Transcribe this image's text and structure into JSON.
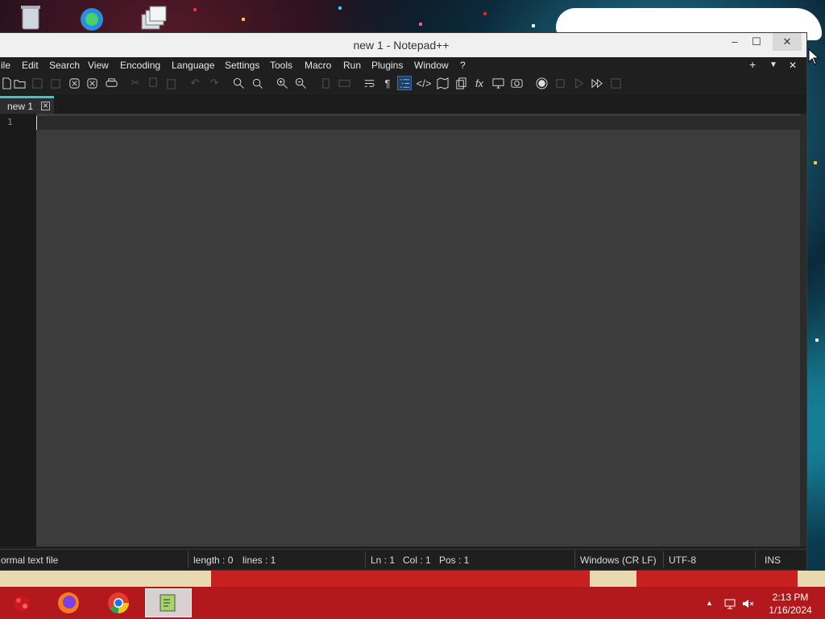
{
  "window": {
    "title": "new 1 - Notepad++",
    "controls": {
      "minimize": "–",
      "maximize": "☐",
      "close": "✕"
    }
  },
  "menubar": {
    "items": [
      "ile",
      "Edit",
      "Search",
      "View",
      "Encoding",
      "Language",
      "Settings",
      "Tools",
      "Macro",
      "Run",
      "Plugins",
      "Window",
      "?"
    ],
    "right": {
      "add": "+",
      "list": "▼",
      "close": "✕"
    }
  },
  "toolbar": {
    "buttons": [
      "new-file-icon",
      "open-file-icon",
      "save-icon",
      "save-all-icon",
      "close-icon",
      "close-all-icon",
      "print-icon",
      "cut-icon",
      "copy-icon",
      "paste-icon",
      "undo-icon",
      "redo-icon",
      "find-icon",
      "replace-icon",
      "zoom-in-icon",
      "zoom-out-icon",
      "sync-vertical-icon",
      "sync-horizontal-icon",
      "word-wrap-icon",
      "show-all-characters-icon",
      "indent-guide-icon",
      "udl-icon",
      "document-map-icon",
      "document-list-icon",
      "function-list-icon",
      "folder-as-workspace-icon",
      "monitoring-icon",
      "record-macro-icon",
      "stop-record-icon",
      "playback-macro-icon",
      "run-macro-multiple-icon",
      "save-macro-icon"
    ]
  },
  "tabs": [
    {
      "label": "new 1",
      "close": "✕"
    }
  ],
  "editor": {
    "line_numbers": [
      "1"
    ],
    "content": ""
  },
  "statusbar": {
    "file_type": "ormal text file",
    "length": "length : 0",
    "lines": "lines : 1",
    "ln": "Ln : 1",
    "col": "Col : 1",
    "pos": "Pos : 1",
    "eol": "Windows (CR LF)",
    "encoding": "UTF-8",
    "mode": "INS"
  },
  "taskbar": {
    "apps": [
      "start-icon",
      "firefox-icon",
      "chrome-icon",
      "notepadpp-icon"
    ],
    "clock_time": "2:13 PM",
    "clock_date": "1/16/2024"
  },
  "colors": {
    "accent_tab": "#3ec9b7",
    "taskbar": "#b3181c",
    "editor_bg": "#3c3c3c",
    "chrome_bg": "#1f1f1f"
  }
}
